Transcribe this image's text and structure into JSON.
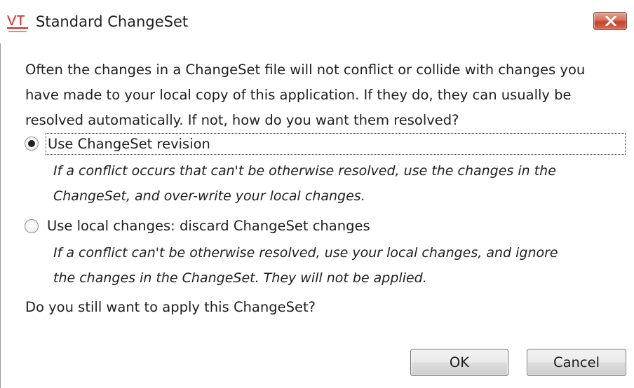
{
  "window": {
    "title": "Standard ChangeSet",
    "icon": "vt-logo-icon",
    "icon_color": "#cc2222"
  },
  "dialog": {
    "intro_lines": [
      "Often the changes in a ChangeSet file will not conflict or collide with changes you",
      "have made to your local copy of this application. If they do, they can usually be",
      "resolved automatically. If not, how do you want them resolved?"
    ],
    "options": [
      {
        "label": "Use ChangeSet revision",
        "checked": true,
        "description_lines": [
          "If a conflict occurs that can't be otherwise resolved, use the changes in the",
          "ChangeSet, and over-write your local changes."
        ]
      },
      {
        "label": "Use local changes: discard ChangeSet changes",
        "checked": false,
        "description_lines": [
          "If a conflict can't be otherwise resolved, use your local changes, and ignore",
          "the changes in the ChangeSet. They will not be applied."
        ]
      }
    ],
    "question": "Do you still want to apply this ChangeSet?",
    "buttons": {
      "ok": "OK",
      "cancel": "Cancel"
    }
  }
}
